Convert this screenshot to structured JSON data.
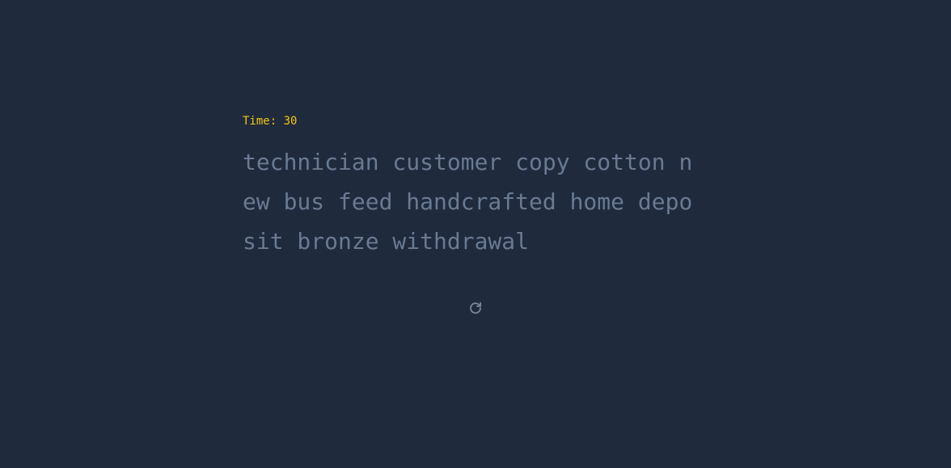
{
  "test": {
    "timer_text": "Time: 30",
    "word_lines": [
      "technician customer copy cotton n",
      "ew bus feed handcrafted home depo",
      "sit bronze withdrawal"
    ]
  },
  "controls": {
    "restart_icon": "restart-icon"
  },
  "colors": {
    "background": "#1f2a3c",
    "timer": "#f5c518",
    "untyped_text": "#6a7a93",
    "icon": "#7d8796"
  }
}
